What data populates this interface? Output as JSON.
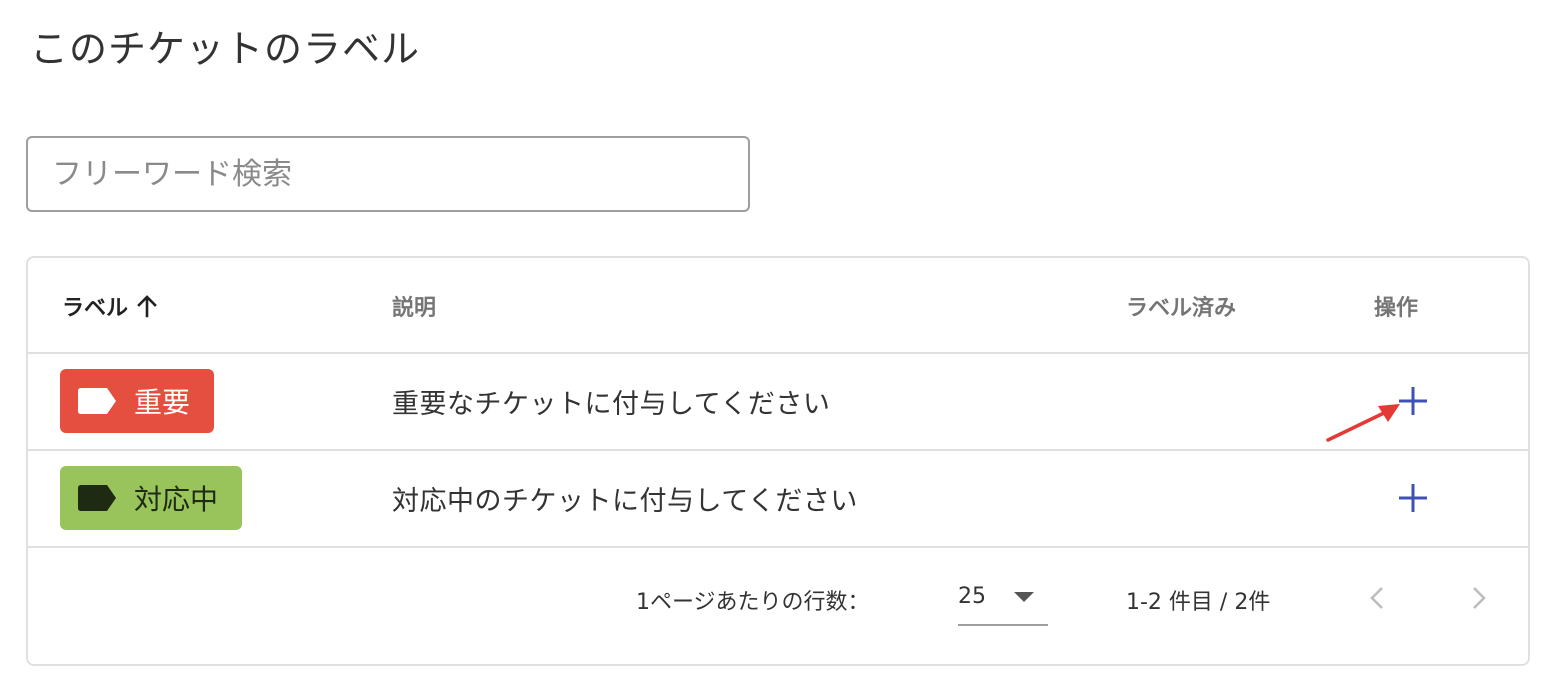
{
  "page": {
    "title": "このチケットのラベル"
  },
  "search": {
    "placeholder": "フリーワード検索",
    "value": ""
  },
  "table": {
    "columns": {
      "label": "ラベル",
      "description": "説明",
      "labeled": "ラベル済み",
      "actions": "操作"
    },
    "sort": {
      "column": "label",
      "direction": "ascending"
    },
    "rows": [
      {
        "label": "重要",
        "label_color": "#e44f3f",
        "label_text_color": "#ffffff",
        "tag_icon_color": "#ffffff",
        "description": "重要なチケットに付与してください",
        "labeled": "",
        "action_icon": "plus-icon"
      },
      {
        "label": "対応中",
        "label_color": "#98c45b",
        "label_text_color": "#1f2a12",
        "tag_icon_color": "#1f2a12",
        "description": "対応中のチケットに付与してください",
        "labeled": "",
        "action_icon": "plus-icon"
      }
    ]
  },
  "pagination": {
    "rows_per_page_label": "1ページあたりの行数：",
    "rows_per_page": "25",
    "range_text": "1-2 件目 / 2件",
    "prev_icon": "chevron-left-icon",
    "next_icon": "chevron-right-icon"
  },
  "colors": {
    "accent_plus": "#3f51b5",
    "annotation_arrow": "#e53935",
    "border": "#e0e0e0"
  }
}
